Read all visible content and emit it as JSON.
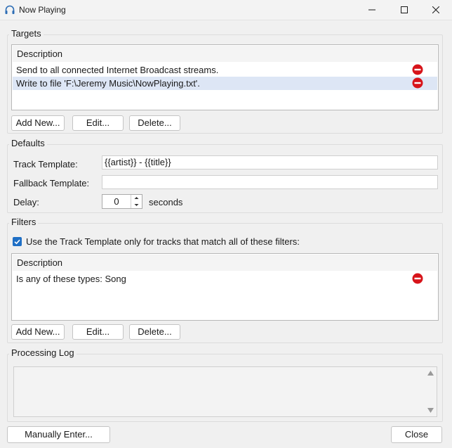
{
  "window": {
    "title": "Now Playing",
    "icon": "headphones-icon"
  },
  "targets": {
    "legend": "Targets",
    "column_header": "Description",
    "rows": [
      {
        "description": "Send to all connected Internet Broadcast streams.",
        "selected": false
      },
      {
        "description": "Write to file 'F:\\Jeremy Music\\NowPlaying.txt'.",
        "selected": true
      }
    ],
    "buttons": {
      "add": "Add New...",
      "edit": "Edit...",
      "delete": "Delete..."
    }
  },
  "defaults": {
    "legend": "Defaults",
    "track_template_label": "Track Template:",
    "track_template_value": "{{artist}} - {{title}}",
    "fallback_template_label": "Fallback Template:",
    "fallback_template_value": "",
    "delay_label": "Delay:",
    "delay_value": "0",
    "delay_unit": "seconds"
  },
  "filters": {
    "legend": "Filters",
    "checkbox_label": "Use the Track Template only for tracks that match all of these filters:",
    "checkbox_checked": true,
    "column_header": "Description",
    "rows": [
      {
        "description": "Is any of these types: Song",
        "selected": false
      }
    ],
    "buttons": {
      "add": "Add New...",
      "edit": "Edit...",
      "delete": "Delete..."
    }
  },
  "processing_log": {
    "legend": "Processing Log",
    "content": ""
  },
  "footer": {
    "manual_enter": "Manually Enter...",
    "close": "Close"
  },
  "colors": {
    "accent": "#1f6fc5",
    "delete_red": "#d7141a",
    "selection": "#dde6f5"
  }
}
